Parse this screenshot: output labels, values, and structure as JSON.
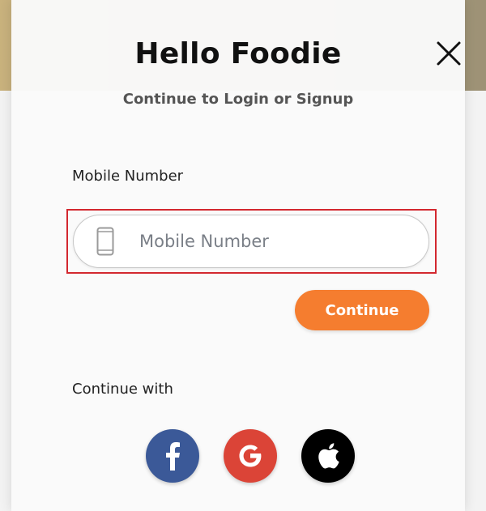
{
  "modal": {
    "title": "Hello Foodie",
    "subtitle": "Continue to Login or Signup",
    "mobile_label": "Mobile Number",
    "mobile_placeholder": "Mobile Number",
    "mobile_value": "",
    "continue_label": "Continue",
    "continue_with_label": "Continue with"
  },
  "social": [
    {
      "name": "facebook",
      "icon": "facebook-icon",
      "color": "#3b5998"
    },
    {
      "name": "google",
      "icon": "google-icon",
      "color": "#db4437"
    },
    {
      "name": "apple",
      "icon": "apple-icon",
      "color": "#000000"
    }
  ],
  "colors": {
    "accent": "#f57d2f",
    "highlight_border": "#d3282f"
  }
}
